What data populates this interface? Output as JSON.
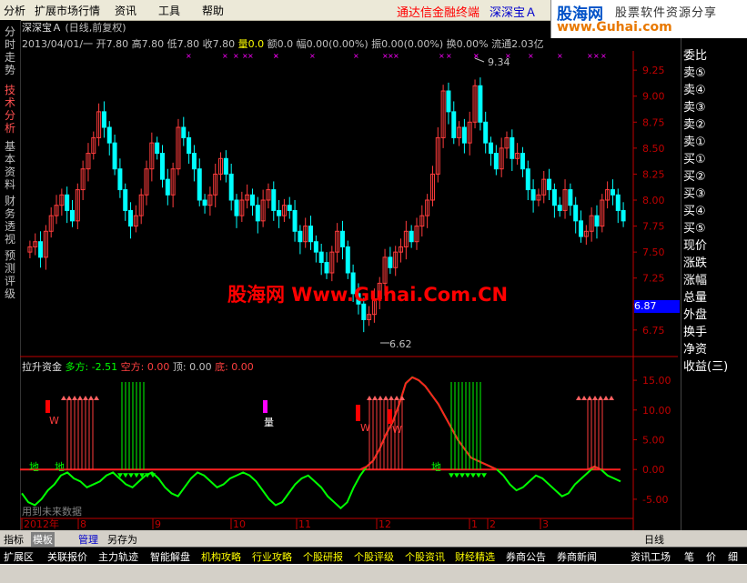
{
  "menu": {
    "items": [
      "分析",
      "扩展市场行情",
      "资讯",
      "工具",
      "帮助"
    ],
    "promo": "通达信金融终端",
    "stock_name": "深深宝Ａ"
  },
  "logo": {
    "brand": "股海网",
    "slogan": "股票软件资源分享",
    "url": "www.Guhai.com"
  },
  "left_tabs": [
    "分时走势",
    "技术分析",
    "基本资料",
    "财务透视",
    "预测评级"
  ],
  "chart_header": {
    "title": "深深宝Ａ",
    "period": "(日线,前复权)"
  },
  "info_line": {
    "date": "2013/04/01/一",
    "open": "开7.80",
    "high": "高7.80",
    "low": "低7.80",
    "close": "收7.80",
    "volume": "量0.0",
    "amount": "额0.0",
    "range": "幅0.00(0.00%)",
    "amplitude": "振0.00(0.00%)",
    "turnover": "换0.00%",
    "float": "流通2.03亿"
  },
  "price_axis": [
    "9.25",
    "9.00",
    "8.75",
    "8.50",
    "8.25",
    "8.00",
    "7.75",
    "7.50",
    "7.25",
    "7.00",
    "6.75"
  ],
  "annotations": {
    "high": "9.34",
    "low": "6.62",
    "current": "6.87"
  },
  "watermark": "股海网 Www.Guhai.Com.CN",
  "indicator": {
    "name": "拉升资金",
    "long_label": "多方: -2.51",
    "short_label": "空方: 0.00",
    "top_label": "顶: 0.00",
    "bottom_label": "底: 0.00",
    "axis": [
      "15.00",
      "10.00",
      "5.00",
      "0.00",
      "-5.00"
    ],
    "signal_liang": "量",
    "signal_w": "W",
    "zone_di": "地",
    "zone_tian": "天",
    "future_note": "用到未来数据"
  },
  "time_axis": [
    "2012年",
    "8",
    "9",
    "10",
    "11",
    "12",
    "1",
    "2",
    "3"
  ],
  "right_panel": {
    "items": [
      "委比",
      "卖⑤",
      "卖④",
      "卖③",
      "卖②",
      "卖①",
      "买①",
      "买②",
      "买③",
      "买④",
      "买⑤",
      "现价",
      "涨跌",
      "涨幅",
      "总量",
      "外盘",
      "换手",
      "净资",
      "收益(三)"
    ]
  },
  "bottom_tabs": [
    "指标",
    "模板",
    "管理",
    "另存为"
  ],
  "period_label": "日线",
  "footer_items": [
    "扩展区",
    "关联报价",
    "主力轨迹",
    "智能解盘",
    "机构攻略",
    "行业攻略",
    "个股研报",
    "个股评级",
    "个股资讯",
    "财经精选",
    "券商公告",
    "券商新闻",
    "资讯工场"
  ],
  "footer_right": [
    "笔",
    "价",
    "细"
  ],
  "colors": {
    "up": "#ff3c3c",
    "down": "#00ffff",
    "accent": "#ff0000",
    "panel": "#000000"
  },
  "chart_data": {
    "type": "candlestick",
    "title": "深深宝Ａ (日线,前复权)",
    "ylim": [
      6.6,
      9.4
    ],
    "high_marker": 9.34,
    "low_marker": 6.62,
    "current_price": 6.87,
    "months": [
      "8",
      "9",
      "10",
      "11",
      "12",
      "1",
      "2",
      "3"
    ],
    "closes": [
      7.55,
      7.6,
      7.45,
      7.7,
      7.85,
      7.95,
      8.05,
      7.9,
      7.8,
      8.1,
      8.3,
      8.45,
      8.6,
      8.85,
      8.7,
      8.55,
      8.3,
      8.1,
      7.9,
      7.75,
      7.85,
      8.05,
      8.3,
      8.55,
      8.45,
      8.2,
      8.05,
      8.3,
      8.7,
      8.6,
      8.45,
      8.3,
      8.0,
      7.95,
      8.05,
      8.25,
      8.4,
      8.25,
      8.0,
      7.85,
      8.0,
      8.05,
      7.95,
      7.8,
      8.0,
      8.1,
      7.9,
      7.85,
      7.95,
      7.9,
      7.7,
      7.6,
      7.75,
      7.6,
      7.5,
      7.4,
      7.3,
      7.5,
      7.7,
      7.55,
      7.3,
      7.1,
      7.0,
      6.85,
      6.9,
      7.05,
      7.2,
      7.45,
      7.35,
      7.5,
      7.55,
      7.7,
      7.6,
      7.75,
      7.85,
      8.0,
      8.25,
      8.6,
      9.05,
      8.85,
      8.6,
      8.7,
      8.55,
      8.75,
      9.1,
      8.75,
      8.55,
      8.45,
      8.3,
      8.5,
      8.6,
      8.4,
      8.45,
      8.3,
      8.1,
      8.0,
      8.05,
      8.2,
      8.1,
      7.95,
      7.9,
      8.1,
      7.95,
      7.8,
      7.65,
      7.7,
      7.85,
      7.75,
      8.0,
      8.1,
      8.05,
      7.9,
      7.8
    ],
    "indicator_line": [
      -4.0,
      -5.5,
      -6.0,
      -5.0,
      -3.5,
      -2.5,
      -1.0,
      -0.5,
      -1.5,
      -2.0,
      -3.0,
      -2.5,
      -2.0,
      -1.0,
      -0.5,
      -1.5,
      -2.5,
      -3.0,
      -2.0,
      -1.0,
      -0.5,
      -1.5,
      -3.0,
      -4.0,
      -4.5,
      -3.0,
      -1.5,
      -0.5,
      -1.0,
      -2.0,
      -3.0,
      -2.5,
      -1.5,
      -1.0,
      -0.5,
      -1.0,
      -2.0,
      -3.5,
      -5.0,
      -6.0,
      -5.5,
      -4.0,
      -2.5,
      -1.5,
      -1.0,
      -2.0,
      -3.0,
      -4.5,
      -5.5,
      -6.5,
      -5.5,
      -3.0,
      -1.0,
      0.5,
      1.5,
      3.5,
      6.0,
      8.0,
      11.0,
      14.5,
      15.5,
      15.0,
      14.0,
      12.5,
      11.0,
      9.0,
      7.0,
      5.0,
      3.5,
      2.0,
      1.5,
      1.0,
      0.5,
      0.0,
      -1.0,
      -2.5,
      -3.5,
      -3.0,
      -2.0,
      -1.0,
      -1.5,
      -2.5,
      -3.5,
      -4.5,
      -4.0,
      -2.5,
      -1.5,
      -0.5,
      0.5,
      0.0,
      -1.0,
      -1.5,
      -2.0
    ],
    "indicator_ylim": [
      -7,
      17
    ]
  }
}
